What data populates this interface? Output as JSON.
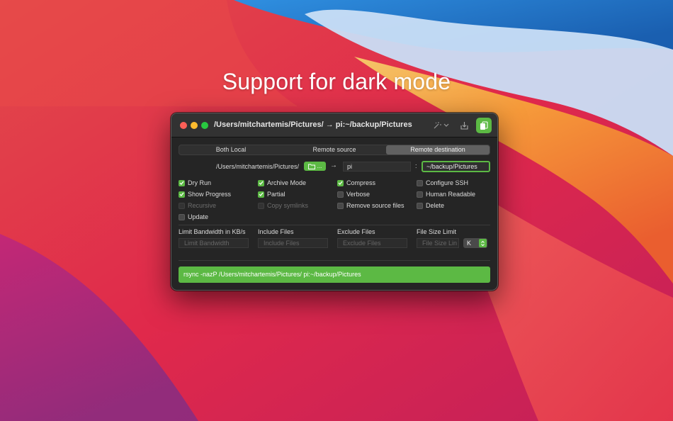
{
  "headline": "Support for dark mode",
  "window": {
    "title": "/Users/mitchartemis/Pictures/ → pi:~/backup/Pictures",
    "toolbar": {
      "icons": [
        "magic-wand-icon",
        "download-icon",
        "copy-icon"
      ]
    }
  },
  "modes": {
    "items": [
      "Both Local",
      "Remote source",
      "Remote destination"
    ],
    "selected": "Remote destination"
  },
  "paths": {
    "local_path": "/Users/mitchartemis/Pictures/",
    "folder_button_label": "...",
    "arrow": "→",
    "host": "pi",
    "colon": ":",
    "remote_path": "~/backup/Pictures"
  },
  "options": {
    "col1": [
      {
        "label": "Dry Run",
        "checked": true,
        "disabled": false
      },
      {
        "label": "Show Progress",
        "checked": true,
        "disabled": false
      },
      {
        "label": "Recursive",
        "checked": false,
        "disabled": true
      },
      {
        "label": "Update",
        "checked": false,
        "disabled": false
      }
    ],
    "col2": [
      {
        "label": "Archive Mode",
        "checked": true,
        "disabled": false
      },
      {
        "label": "Partial",
        "checked": true,
        "disabled": false
      },
      {
        "label": "Copy symlinks",
        "checked": false,
        "disabled": true
      }
    ],
    "col3": [
      {
        "label": "Compress",
        "checked": true,
        "disabled": false
      },
      {
        "label": "Verbose",
        "checked": false,
        "disabled": false
      },
      {
        "label": "Remove source files",
        "checked": false,
        "disabled": false
      }
    ],
    "col4": [
      {
        "label": "Configure SSH",
        "checked": false,
        "disabled": false
      },
      {
        "label": "Human Readable",
        "checked": false,
        "disabled": false
      },
      {
        "label": "Delete",
        "checked": false,
        "disabled": false
      }
    ]
  },
  "fields": {
    "bandwidth": {
      "label": "Limit Bandwidth in KB/s",
      "placeholder": "Limit Bandwidth"
    },
    "include": {
      "label": "Include Files",
      "placeholder": "Include Files"
    },
    "exclude": {
      "label": "Exclude Files",
      "placeholder": "Exclude Files"
    },
    "filesize": {
      "label": "File Size Limit",
      "placeholder": "File Size Lin"
    },
    "unit": "K"
  },
  "command": "rsync -nazP /Users/mitchartemis/Pictures/ pi:~/backup/Pictures",
  "colors": {
    "accent_green": "#5cb944",
    "window_bg": "#252525",
    "titlebar_bg": "#323232"
  }
}
